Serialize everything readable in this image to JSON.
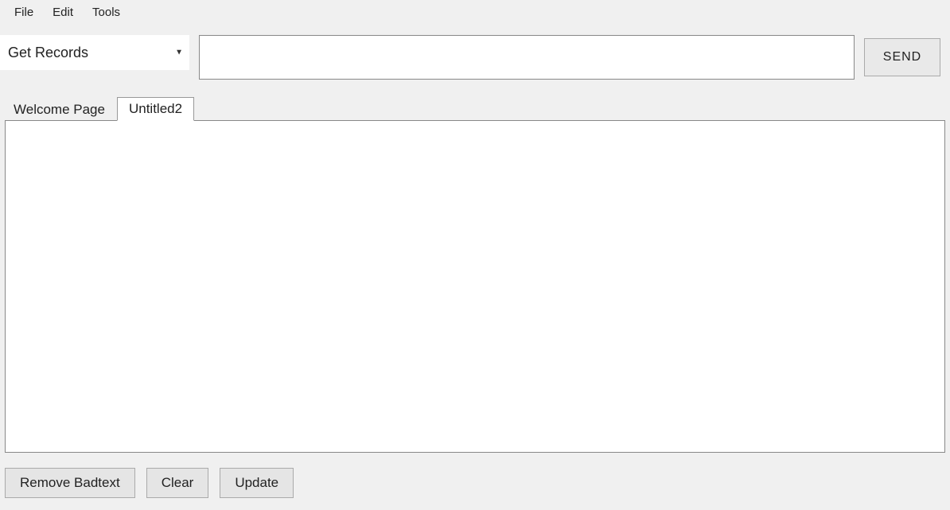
{
  "menu": {
    "items": [
      "File",
      "Edit",
      "Tools"
    ]
  },
  "action_row": {
    "combo_selected": "Get Records",
    "query_value": "",
    "send_label": "SEND"
  },
  "tabs": [
    {
      "label": "Welcome Page",
      "active": false
    },
    {
      "label": "Untitled2",
      "active": true
    }
  ],
  "content": {
    "text": ""
  },
  "bottom_buttons": {
    "remove_badtext": "Remove Badtext",
    "clear": "Clear",
    "update": "Update"
  }
}
